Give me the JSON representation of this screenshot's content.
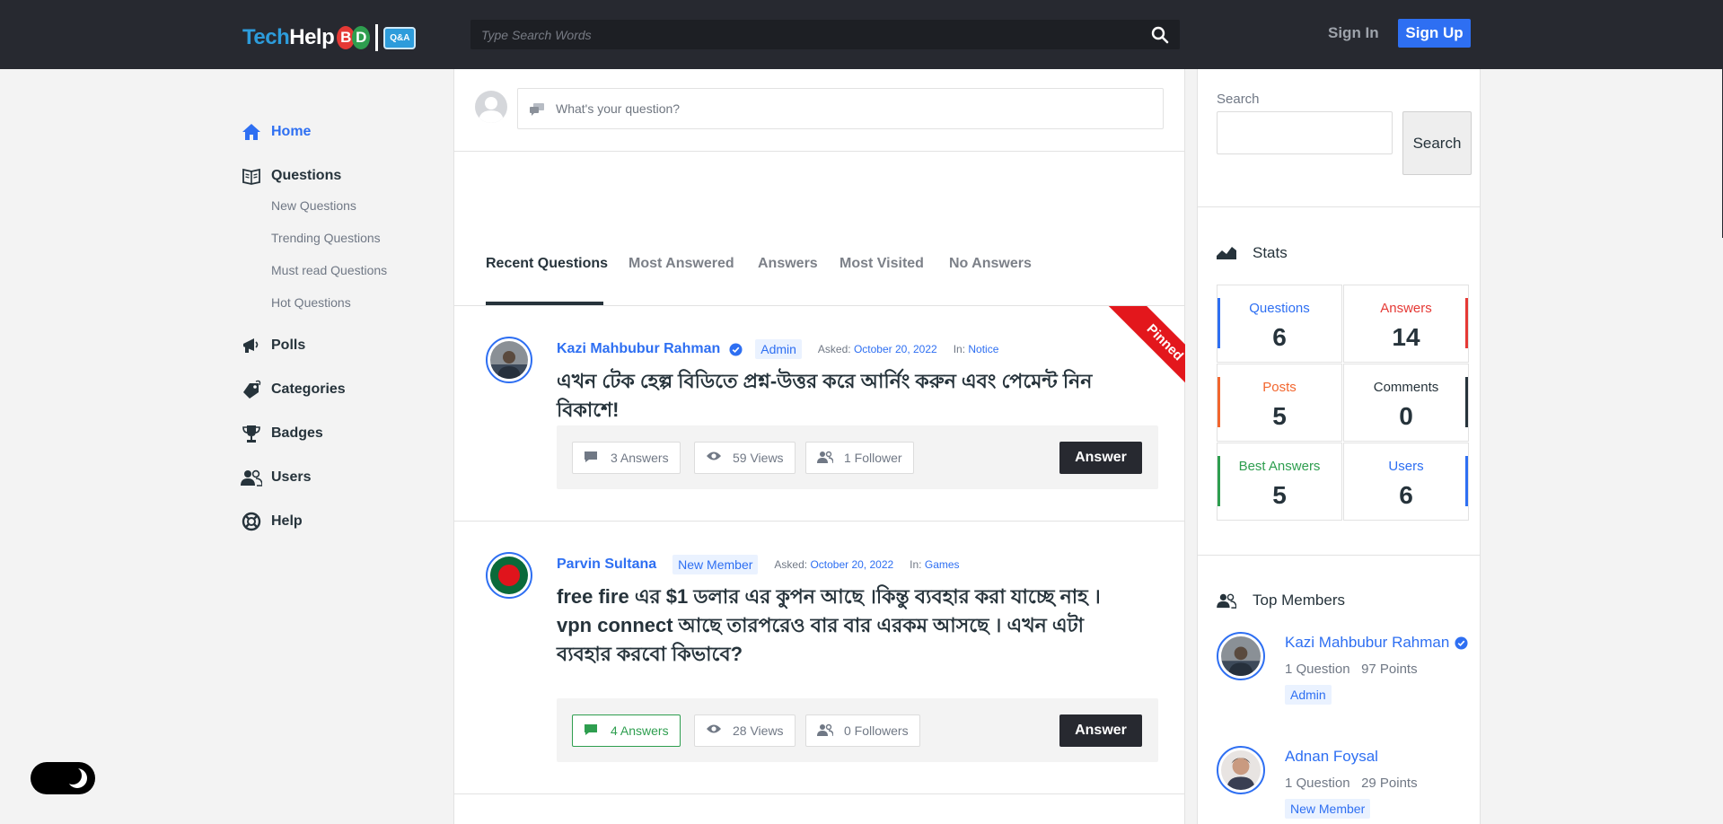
{
  "header": {
    "logo_text1": "Tech",
    "logo_text2": "Help",
    "logo_b": "B",
    "logo_d": "D",
    "logo_qa": "Q&A",
    "search_placeholder": "Type Search Words",
    "signin_label": "Sign In",
    "signup_label": "Sign Up"
  },
  "nav": {
    "home": "Home",
    "questions": "Questions",
    "sub": [
      "New Questions",
      "Trending Questions",
      "Must read Questions",
      "Hot Questions"
    ],
    "polls": "Polls",
    "categories": "Categories",
    "badges": "Badges",
    "users": "Users",
    "help": "Help"
  },
  "ask": {
    "placeholder": "What's your question?"
  },
  "tabs": [
    "Recent Questions",
    "Most Answered",
    "Answers",
    "Most Visited",
    "No Answers"
  ],
  "questions": [
    {
      "author": "Kazi Mahbubur Rahman",
      "role": "Admin",
      "asked_label": "Asked:",
      "date": "October 20, 2022",
      "in_label": "In:",
      "category": "Notice",
      "title": "এখন টেক হেল্প বিডিতে প্রশ্ন-উত্তর করে আর্নিং করুন এবং পেমেন্ট নিন বিকাশে!",
      "answers": "3 Answers",
      "views": "59 Views",
      "followers": "1 Follower",
      "answer_btn": "Answer",
      "ribbon": "Pinned"
    },
    {
      "author": "Parvin Sultana",
      "role": "New Member",
      "asked_label": "Asked:",
      "date": "October 20, 2022",
      "in_label": "In:",
      "category": "Games",
      "title": "free fire এর $1 ডলার এর কুপন আছে ।কিন্তু ব্যবহার করা যাচ্ছে নাহ । vpn connect আছে তারপরেও বার বার এরকম আসছে । এখন এটা ব্যবহার করবো কিভাবে?",
      "answers": "4 Answers",
      "views": "28 Views",
      "followers": "0 Followers",
      "answer_btn": "Answer"
    }
  ],
  "sidebar": {
    "search_label": "Search",
    "search_button": "Search",
    "stats_title": "Stats",
    "stats": [
      {
        "label": "Questions",
        "value": "6",
        "color": "#2e6ff2"
      },
      {
        "label": "Answers",
        "value": "14",
        "color": "#e53935"
      },
      {
        "label": "Posts",
        "value": "5",
        "color": "#f2662e"
      },
      {
        "label": "Comments",
        "value": "0",
        "color": "#26333b"
      },
      {
        "label": "Best Answers",
        "value": "5",
        "color": "#2e9e4f"
      },
      {
        "label": "Users",
        "value": "6",
        "color": "#2e6ff2"
      }
    ],
    "top_members_title": "Top Members",
    "members": [
      {
        "name": "Kazi Mahbubur Rahman",
        "questions": "1 Question",
        "points": "97 Points",
        "role": "Admin"
      },
      {
        "name": "Adnan Foysal",
        "questions": "1 Question",
        "points": "29 Points",
        "role": "New Member"
      }
    ]
  },
  "colors": {
    "accent": "#2e6ff2",
    "header_bg": "#272930",
    "pinned": "#e3171c"
  }
}
